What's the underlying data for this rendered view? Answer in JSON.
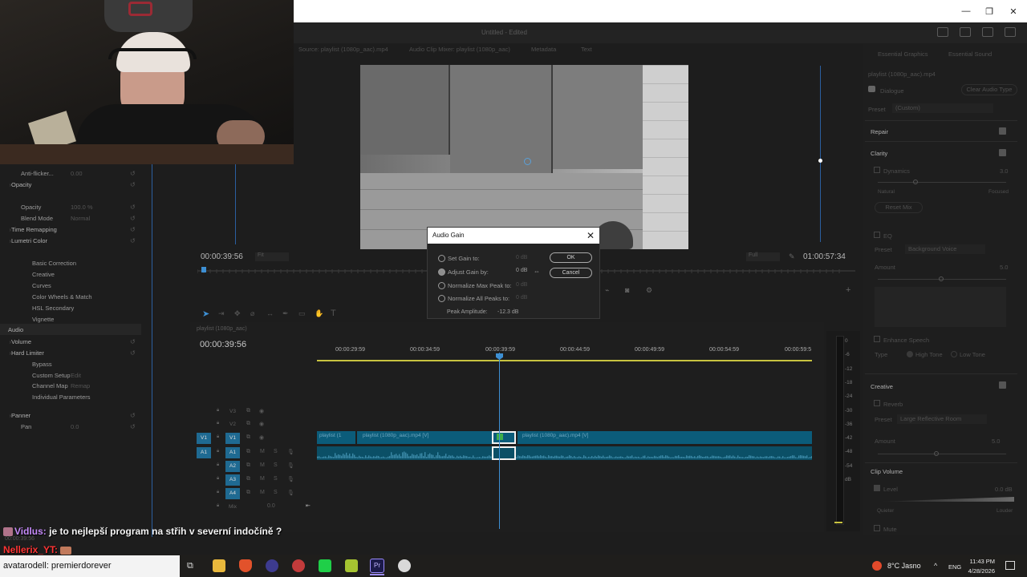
{
  "window": {
    "doc_title": "Untitled - Edited",
    "min": "—",
    "max": "❐",
    "close": "✕"
  },
  "monitor": {
    "tabs": [
      "Source: playlist (1080p_aac).mp4",
      "Audio Clip Mixer: playlist (1080p_aac)",
      "Metadata",
      "Text"
    ],
    "timecode_left": "00:00:39:56",
    "timecode_right": "01:00:57:34",
    "fit": "Fit",
    "quality": "Full"
  },
  "effects": {
    "rows": [
      {
        "label": "Anti-flicker...",
        "value": "0.00",
        "type": "prop"
      },
      {
        "label": "Opacity",
        "value": "",
        "type": "section"
      },
      {
        "label": "Opacity",
        "value": "100.0 %",
        "type": "prop"
      },
      {
        "label": "Blend Mode",
        "value": "Normal",
        "type": "prop"
      },
      {
        "label": "Time Remapping",
        "value": "",
        "type": "section"
      },
      {
        "label": "Lumetri Color",
        "value": "",
        "type": "section"
      },
      {
        "label": "Basic Correction",
        "value": "",
        "type": "sub"
      },
      {
        "label": "Creative",
        "value": "",
        "type": "sub"
      },
      {
        "label": "Curves",
        "value": "",
        "type": "sub"
      },
      {
        "label": "Color Wheels & Match",
        "value": "",
        "type": "sub"
      },
      {
        "label": "HSL Secondary",
        "value": "",
        "type": "sub"
      },
      {
        "label": "Vignette",
        "value": "",
        "type": "sub"
      },
      {
        "label": "Audio",
        "value": "",
        "type": "header"
      },
      {
        "label": "Volume",
        "value": "",
        "type": "section"
      },
      {
        "label": "Hard Limiter",
        "value": "",
        "type": "section"
      },
      {
        "label": "Bypass",
        "value": "",
        "type": "sub"
      },
      {
        "label": "Custom Setup",
        "value": "Edit",
        "type": "sub"
      },
      {
        "label": "Channel Map",
        "value": "Remap",
        "type": "sub"
      },
      {
        "label": "Individual Parameters",
        "value": "",
        "type": "sub"
      },
      {
        "label": "Panner",
        "value": "",
        "type": "section"
      },
      {
        "label": "Pan",
        "value": "0.0",
        "type": "prop"
      }
    ],
    "bottom_tc": "00:00:39:56"
  },
  "dialog": {
    "title": "Audio Gain",
    "options": [
      {
        "label": "Set Gain to:",
        "value": "0 dB",
        "selected": false
      },
      {
        "label": "Adjust Gain by:",
        "value": "0 dB",
        "selected": true
      },
      {
        "label": "Normalize Max Peak to:",
        "value": "0 dB",
        "selected": false
      },
      {
        "label": "Normalize All Peaks to:",
        "value": "0 dB",
        "selected": false
      }
    ],
    "ok": "OK",
    "cancel": "Cancel",
    "peak_label": "Peak Amplitude:",
    "peak_value": "-12.3 dB"
  },
  "timeline": {
    "tab": "playlist (1080p_aac)",
    "timecode": "00:00:39:56",
    "ruler": [
      "00:00:29:59",
      "00:00:34:59",
      "00:00:39:59",
      "00:00:44:59",
      "00:00:49:59",
      "00:00:54:59",
      "00:00:59:5"
    ],
    "tracks": [
      "V3",
      "V2",
      "V1",
      "A1",
      "A2",
      "A3",
      "A4",
      "Mix"
    ],
    "mix_value": "0.0",
    "clips": [
      "playlist (1",
      "playlist (1080p_aac).mp4 [V]",
      "playlist (1080p_aac).mp4 [V]"
    ],
    "vu_labels": [
      "0",
      "-6",
      "-12",
      "-18",
      "-24",
      "-30",
      "-36",
      "-42",
      "-48",
      "-54",
      "dB"
    ]
  },
  "essential_sound": {
    "tabs": [
      "Essential Graphics",
      "Essential Sound"
    ],
    "clip_name": "playlist (1080p_aac).mp4",
    "type": "Dialogue",
    "clear_btn": "Clear Audio Type",
    "preset_label": "Preset",
    "preset_value": "(Custom)",
    "repair": "Repair",
    "clarity": "Clarity",
    "dynamics": "Dynamics",
    "dyn_value": "3.0",
    "natural": "Natural",
    "focused": "Focused",
    "reset": "Reset Mix",
    "eq": "EQ",
    "eq_preset_value": "Background Voice",
    "amount": "Amount",
    "amount_value": "5.0",
    "enhance_speech": "Enhance Speech",
    "type_label": "Type",
    "high_tone": "High Tone",
    "low_tone": "Low Tone",
    "creative": "Creative",
    "reverb": "Reverb",
    "reverb_preset": "Large Reflective Room",
    "reverb_amount": "5.0",
    "clip_volume": "Clip Volume",
    "level": "Level",
    "level_value": "0.0 dB",
    "quieter": "Quieter",
    "louder": "Louder",
    "mute": "Mute"
  },
  "chat": {
    "user1": "Vidlus:",
    "msg1": "je to nejlepší program na střih v severní indočíně ?",
    "user2": "Nellerix_YT:"
  },
  "taskbar": {
    "search": "avatarodell: premierdorever",
    "weather": "8°C  Jasno",
    "lang": "ENG",
    "time": "11:43 PM",
    "date": "4/28/2026"
  },
  "colors": {
    "accent": "#1f6a92",
    "playhead": "#3d8fd3",
    "workbar": "#c8c340"
  }
}
